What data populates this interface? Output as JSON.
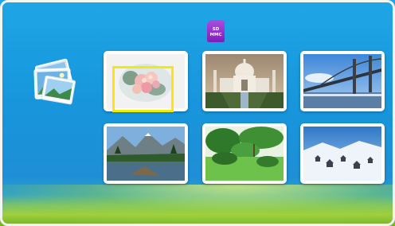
{
  "storage": {
    "label_line1": "SD",
    "label_line2": "MMC",
    "icon": "sd-mmc-card-icon"
  },
  "gallery": {
    "icon": "photo-gallery-icon"
  },
  "thumbnails": [
    {
      "subject": "flowers",
      "selected": true
    },
    {
      "subject": "taj-mahal",
      "selected": false
    },
    {
      "subject": "bridge",
      "selected": false
    },
    {
      "subject": "mountain-lake",
      "selected": false
    },
    {
      "subject": "green-park",
      "selected": false
    },
    {
      "subject": "snow-village",
      "selected": false
    }
  ],
  "colors": {
    "background": "#1796dc",
    "selection": "#f5e80b",
    "storage_icon": "#9b36d0"
  }
}
